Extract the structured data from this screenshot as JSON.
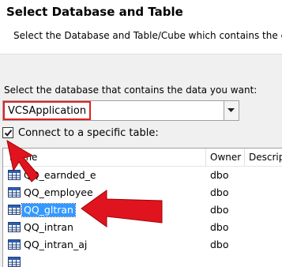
{
  "header": {
    "title": "Select Database and Table",
    "subtitle": "Select the Database and Table/Cube which contains the da"
  },
  "database": {
    "label": "Select the database that contains the data you want:",
    "selected": "VCSApplication"
  },
  "connect_checkbox": {
    "label": "Connect to a specific table:",
    "checked": true
  },
  "table_list": {
    "columns": [
      "Name",
      "Owner",
      "Descrip"
    ],
    "rows": [
      {
        "name": "QQ_earnded_e",
        "owner": "dbo"
      },
      {
        "name": "QQ_employee",
        "owner": "dbo"
      },
      {
        "name": "QQ_gltran",
        "owner": "dbo",
        "selected": true
      },
      {
        "name": "QQ_intran",
        "owner": "dbo"
      },
      {
        "name": "QQ_intran_aj",
        "owner": "dbo"
      },
      {
        "name": "",
        "owner": ""
      }
    ]
  },
  "colors": {
    "highlight": "#e02020",
    "selection": "#3399ff",
    "arrow": "#e0141e"
  },
  "icons": [
    "chevron-down-icon",
    "checkmark-icon",
    "table-icon",
    "red-arrow-icon"
  ]
}
